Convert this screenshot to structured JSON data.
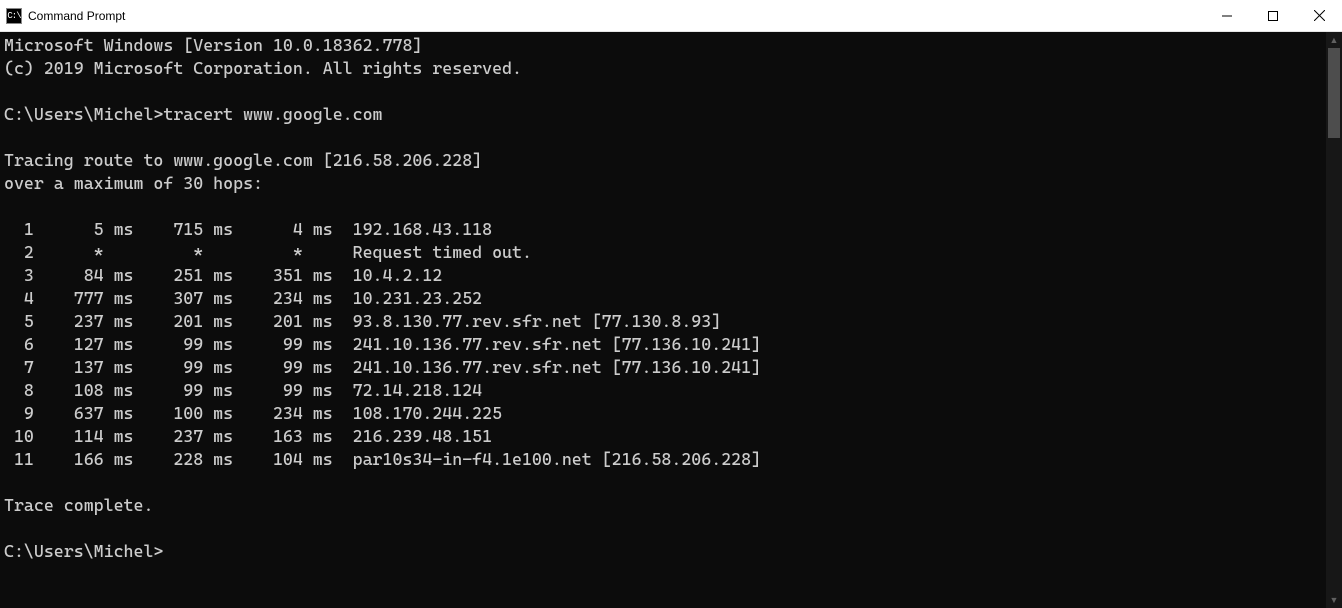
{
  "titlebar": {
    "icon_text": "C:\\",
    "title": "Command Prompt"
  },
  "terminal": {
    "banner_line1": "Microsoft Windows [Version 10.0.18362.778]",
    "banner_line2": "(c) 2019 Microsoft Corporation. All rights reserved.",
    "prompt1_path": "C:\\Users\\Michel>",
    "prompt1_cmd": "tracert www.google.com",
    "trace_target_line": "Tracing route to www.google.com [216.58.206.228]",
    "trace_max_hops_line": "over a maximum of 30 hops:",
    "trace_complete": "Trace complete.",
    "prompt2_path": "C:\\Users\\Michel>",
    "hops": [
      {
        "n": "1",
        "t1": "5 ms",
        "t2": "715 ms",
        "t3": "4 ms",
        "host": "192.168.43.118"
      },
      {
        "n": "2",
        "t1": "*",
        "t2": "*",
        "t3": "*",
        "host": "Request timed out."
      },
      {
        "n": "3",
        "t1": "84 ms",
        "t2": "251 ms",
        "t3": "351 ms",
        "host": "10.4.2.12"
      },
      {
        "n": "4",
        "t1": "777 ms",
        "t2": "307 ms",
        "t3": "234 ms",
        "host": "10.231.23.252"
      },
      {
        "n": "5",
        "t1": "237 ms",
        "t2": "201 ms",
        "t3": "201 ms",
        "host": "93.8.130.77.rev.sfr.net [77.130.8.93]"
      },
      {
        "n": "6",
        "t1": "127 ms",
        "t2": "99 ms",
        "t3": "99 ms",
        "host": "241.10.136.77.rev.sfr.net [77.136.10.241]"
      },
      {
        "n": "7",
        "t1": "137 ms",
        "t2": "99 ms",
        "t3": "99 ms",
        "host": "241.10.136.77.rev.sfr.net [77.136.10.241]"
      },
      {
        "n": "8",
        "t1": "108 ms",
        "t2": "99 ms",
        "t3": "99 ms",
        "host": "72.14.218.124"
      },
      {
        "n": "9",
        "t1": "637 ms",
        "t2": "100 ms",
        "t3": "234 ms",
        "host": "108.170.244.225"
      },
      {
        "n": "10",
        "t1": "114 ms",
        "t2": "237 ms",
        "t3": "163 ms",
        "host": "216.239.48.151"
      },
      {
        "n": "11",
        "t1": "166 ms",
        "t2": "228 ms",
        "t3": "104 ms",
        "host": "par10s34-in-f4.1e100.net [216.58.206.228]"
      }
    ]
  }
}
